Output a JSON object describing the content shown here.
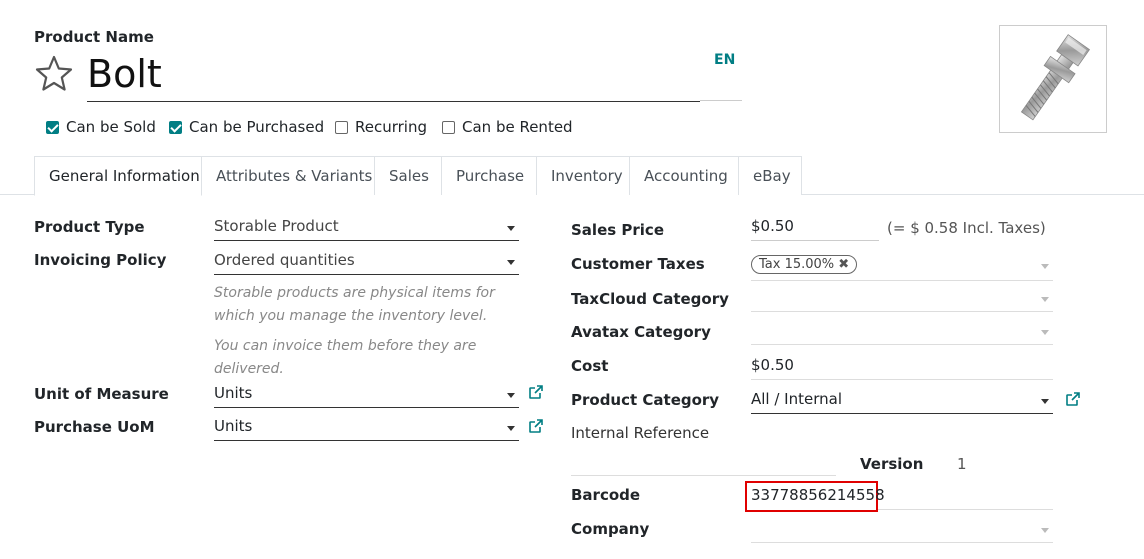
{
  "header": {
    "product_name_label": "Product Name",
    "product_name": "Bolt",
    "lang": "EN"
  },
  "flags": [
    {
      "label": "Can be Sold",
      "checked": true
    },
    {
      "label": "Can be Purchased",
      "checked": true
    },
    {
      "label": "Recurring",
      "checked": false
    },
    {
      "label": "Can be Rented",
      "checked": false
    }
  ],
  "tabs": [
    "General Information",
    "Attributes & Variants",
    "Sales",
    "Purchase",
    "Inventory",
    "Accounting",
    "eBay"
  ],
  "left": {
    "product_type_label": "Product Type",
    "product_type": "Storable Product",
    "invoicing_policy_label": "Invoicing Policy",
    "invoicing_policy": "Ordered quantities",
    "help1": "Storable products are physical items for which you manage the inventory level.",
    "help2": "You can invoice them before they are delivered.",
    "uom_label": "Unit of Measure",
    "uom": "Units",
    "purchase_uom_label": "Purchase UoM",
    "purchase_uom": "Units"
  },
  "right": {
    "sales_price_label": "Sales Price",
    "sales_price": "$0.50",
    "incl_taxes": "(= $ 0.58 Incl. Taxes)",
    "customer_taxes_label": "Customer Taxes",
    "tax_tag": "Tax 15.00%",
    "taxcloud_label": "TaxCloud Category",
    "avatax_label": "Avatax Category",
    "cost_label": "Cost",
    "cost": "$0.50",
    "category_label": "Product Category",
    "category": "All / Internal",
    "internal_ref_label": "Internal Reference",
    "version_label": "Version",
    "version": "1",
    "barcode_label": "Barcode",
    "barcode": "33778856214558",
    "company_label": "Company"
  },
  "colors": {
    "accent": "#017e84",
    "highlight": "#e00000"
  }
}
